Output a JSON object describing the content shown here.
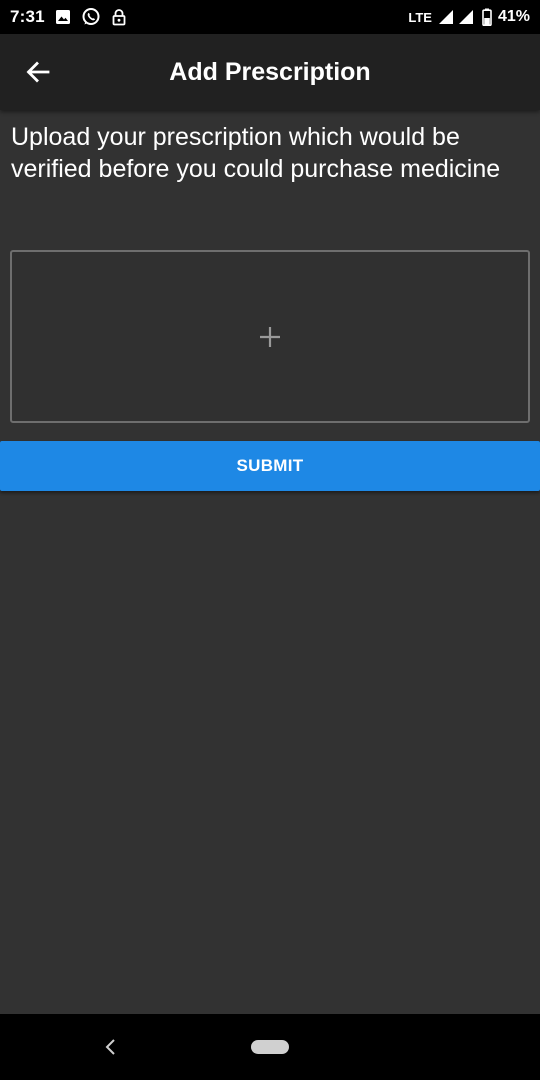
{
  "status_bar": {
    "time": "7:31",
    "network": "LTE",
    "battery": "41%",
    "icons": [
      "image-icon",
      "whatsapp-icon",
      "lock-icon",
      "signal-icon",
      "signal-icon",
      "battery-icon"
    ]
  },
  "app_bar": {
    "title": "Add Prescription",
    "back_icon": "arrow-left-icon",
    "background": "#212121"
  },
  "main": {
    "description": "Upload your prescription which would be verified before you could purchase medicine",
    "upload_box": {
      "icon": "plus-icon"
    },
    "submit_label": "SUBMIT",
    "submit_color": "#1e88e5",
    "background": "#323232"
  },
  "nav_bar": {
    "back_icon": "nav-back-icon",
    "home_icon": "nav-home-pill"
  }
}
